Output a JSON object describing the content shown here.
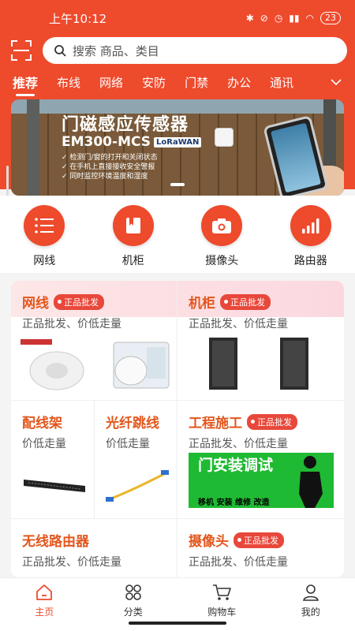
{
  "status": {
    "time": "上午10:12",
    "battery": "23"
  },
  "search": {
    "placeholder": "搜索 商品、类目"
  },
  "categories": [
    "推荐",
    "布线",
    "网络",
    "安防",
    "门禁",
    "办公",
    "通讯"
  ],
  "banner": {
    "title": "门磁感应传感器",
    "model": "EM300-MCS",
    "logo": "LoRaWAN",
    "bullets": [
      "检测门/窗的打开和关闭状态",
      "在手机上直接接收安全警报",
      "同时监控环境温度和湿度"
    ]
  },
  "quick": [
    {
      "label": "网线",
      "icon": "list-icon"
    },
    {
      "label": "机柜",
      "icon": "book-icon"
    },
    {
      "label": "摄像头",
      "icon": "camera-icon"
    },
    {
      "label": "路由器",
      "icon": "signal-bars-icon"
    }
  ],
  "grid": [
    {
      "title": "网线",
      "badge": "正品批发",
      "sub": "正品批发、价低走量"
    },
    {
      "title": "机柜",
      "badge": "正品批发",
      "sub": "正品批发、价低走量"
    },
    {
      "title": "配线架",
      "sub": "价低走量"
    },
    {
      "title": "光纤跳线",
      "sub": "价低走量"
    },
    {
      "title": "工程施工",
      "badge": "正品批发",
      "sub": "正品批发、价低走量",
      "img_text": "门安装调试",
      "img_sub": "移机 安装 维修 改造"
    },
    {
      "title": "无线路由器",
      "sub": "正品批发、价低走量"
    },
    {
      "title": "摄像头",
      "badge": "正品批发",
      "sub": "正品批发、价低走量"
    }
  ],
  "tabs": [
    {
      "label": "主页",
      "icon": "home-icon",
      "active": true
    },
    {
      "label": "分类",
      "icon": "grid-icon"
    },
    {
      "label": "购物车",
      "icon": "cart-icon"
    },
    {
      "label": "我的",
      "icon": "user-icon"
    }
  ],
  "colors": {
    "brand": "#ee4a2c",
    "title_orange": "#e3561c",
    "badge": "#e8483b"
  }
}
